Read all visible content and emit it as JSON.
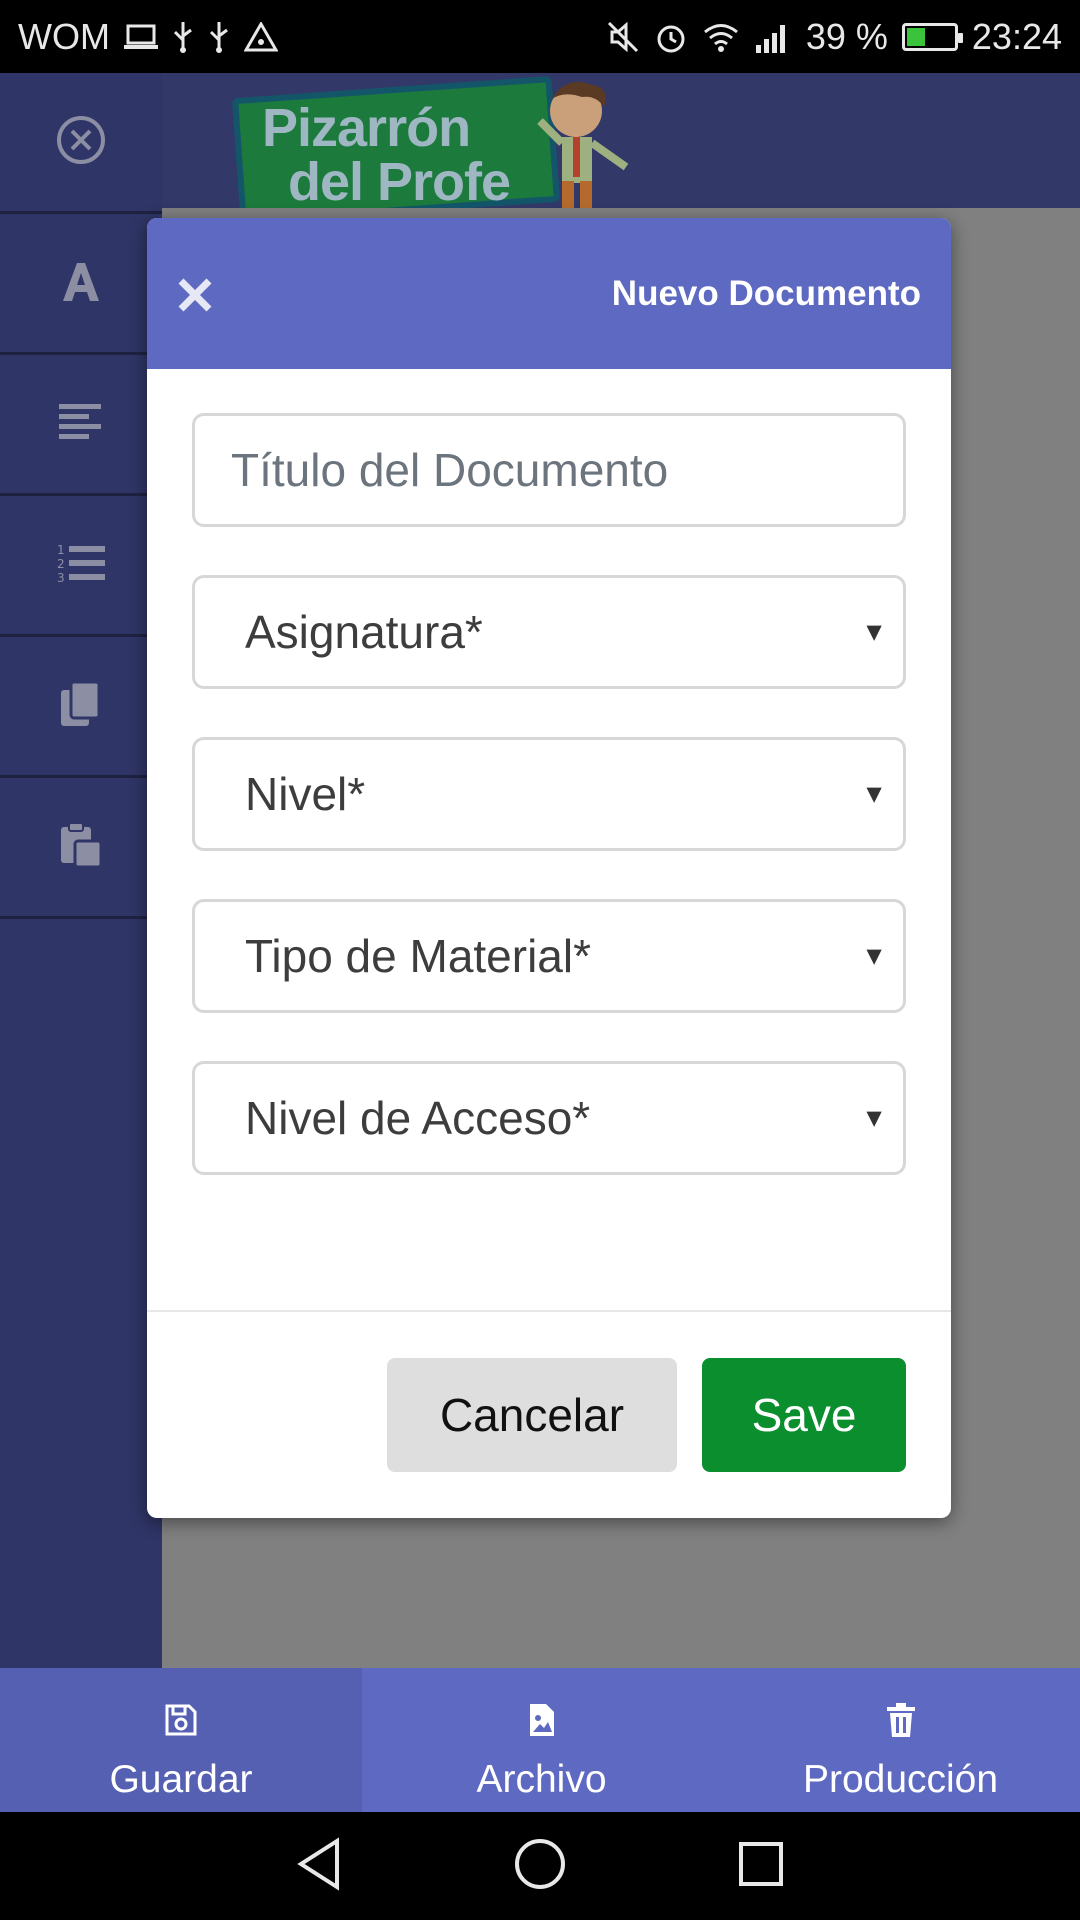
{
  "status_bar": {
    "carrier": "WOM",
    "battery_percent": "39 %",
    "time": "23:24",
    "icons_left": [
      "laptop-icon",
      "usb-icon",
      "usb-icon",
      "warning-icon"
    ],
    "icons_right": [
      "mute-icon",
      "alarm-icon",
      "wifi-icon",
      "signal-icon",
      "battery-icon"
    ]
  },
  "logo": {
    "line1": "Pizarrón",
    "line2": "del Profe"
  },
  "sidebar": {
    "items": [
      {
        "icon": "close-circle-icon"
      },
      {
        "icon": "font-icon"
      },
      {
        "icon": "align-left-icon"
      },
      {
        "icon": "numbered-list-icon"
      },
      {
        "icon": "copy-icon"
      },
      {
        "icon": "paste-icon"
      }
    ]
  },
  "modal": {
    "title": "Nuevo Documento",
    "title_input_placeholder": "Título del Documento",
    "selects": [
      {
        "label": "Asignatura*"
      },
      {
        "label": "Nivel*"
      },
      {
        "label": "Tipo de Material*"
      },
      {
        "label": "Nivel de Acceso*"
      }
    ],
    "cancel_label": "Cancelar",
    "save_label": "Save"
  },
  "tabbar": {
    "tabs": [
      {
        "label": "Guardar",
        "icon": "save-icon"
      },
      {
        "label": "Archivo",
        "icon": "file-image-icon"
      },
      {
        "label": "Producción",
        "icon": "trash-icon"
      }
    ]
  },
  "colors": {
    "modal_header": "#5e69c2",
    "save_button": "#0b8e2e",
    "sidebar": "#2f3566",
    "tabbar": "#5e69c2"
  }
}
